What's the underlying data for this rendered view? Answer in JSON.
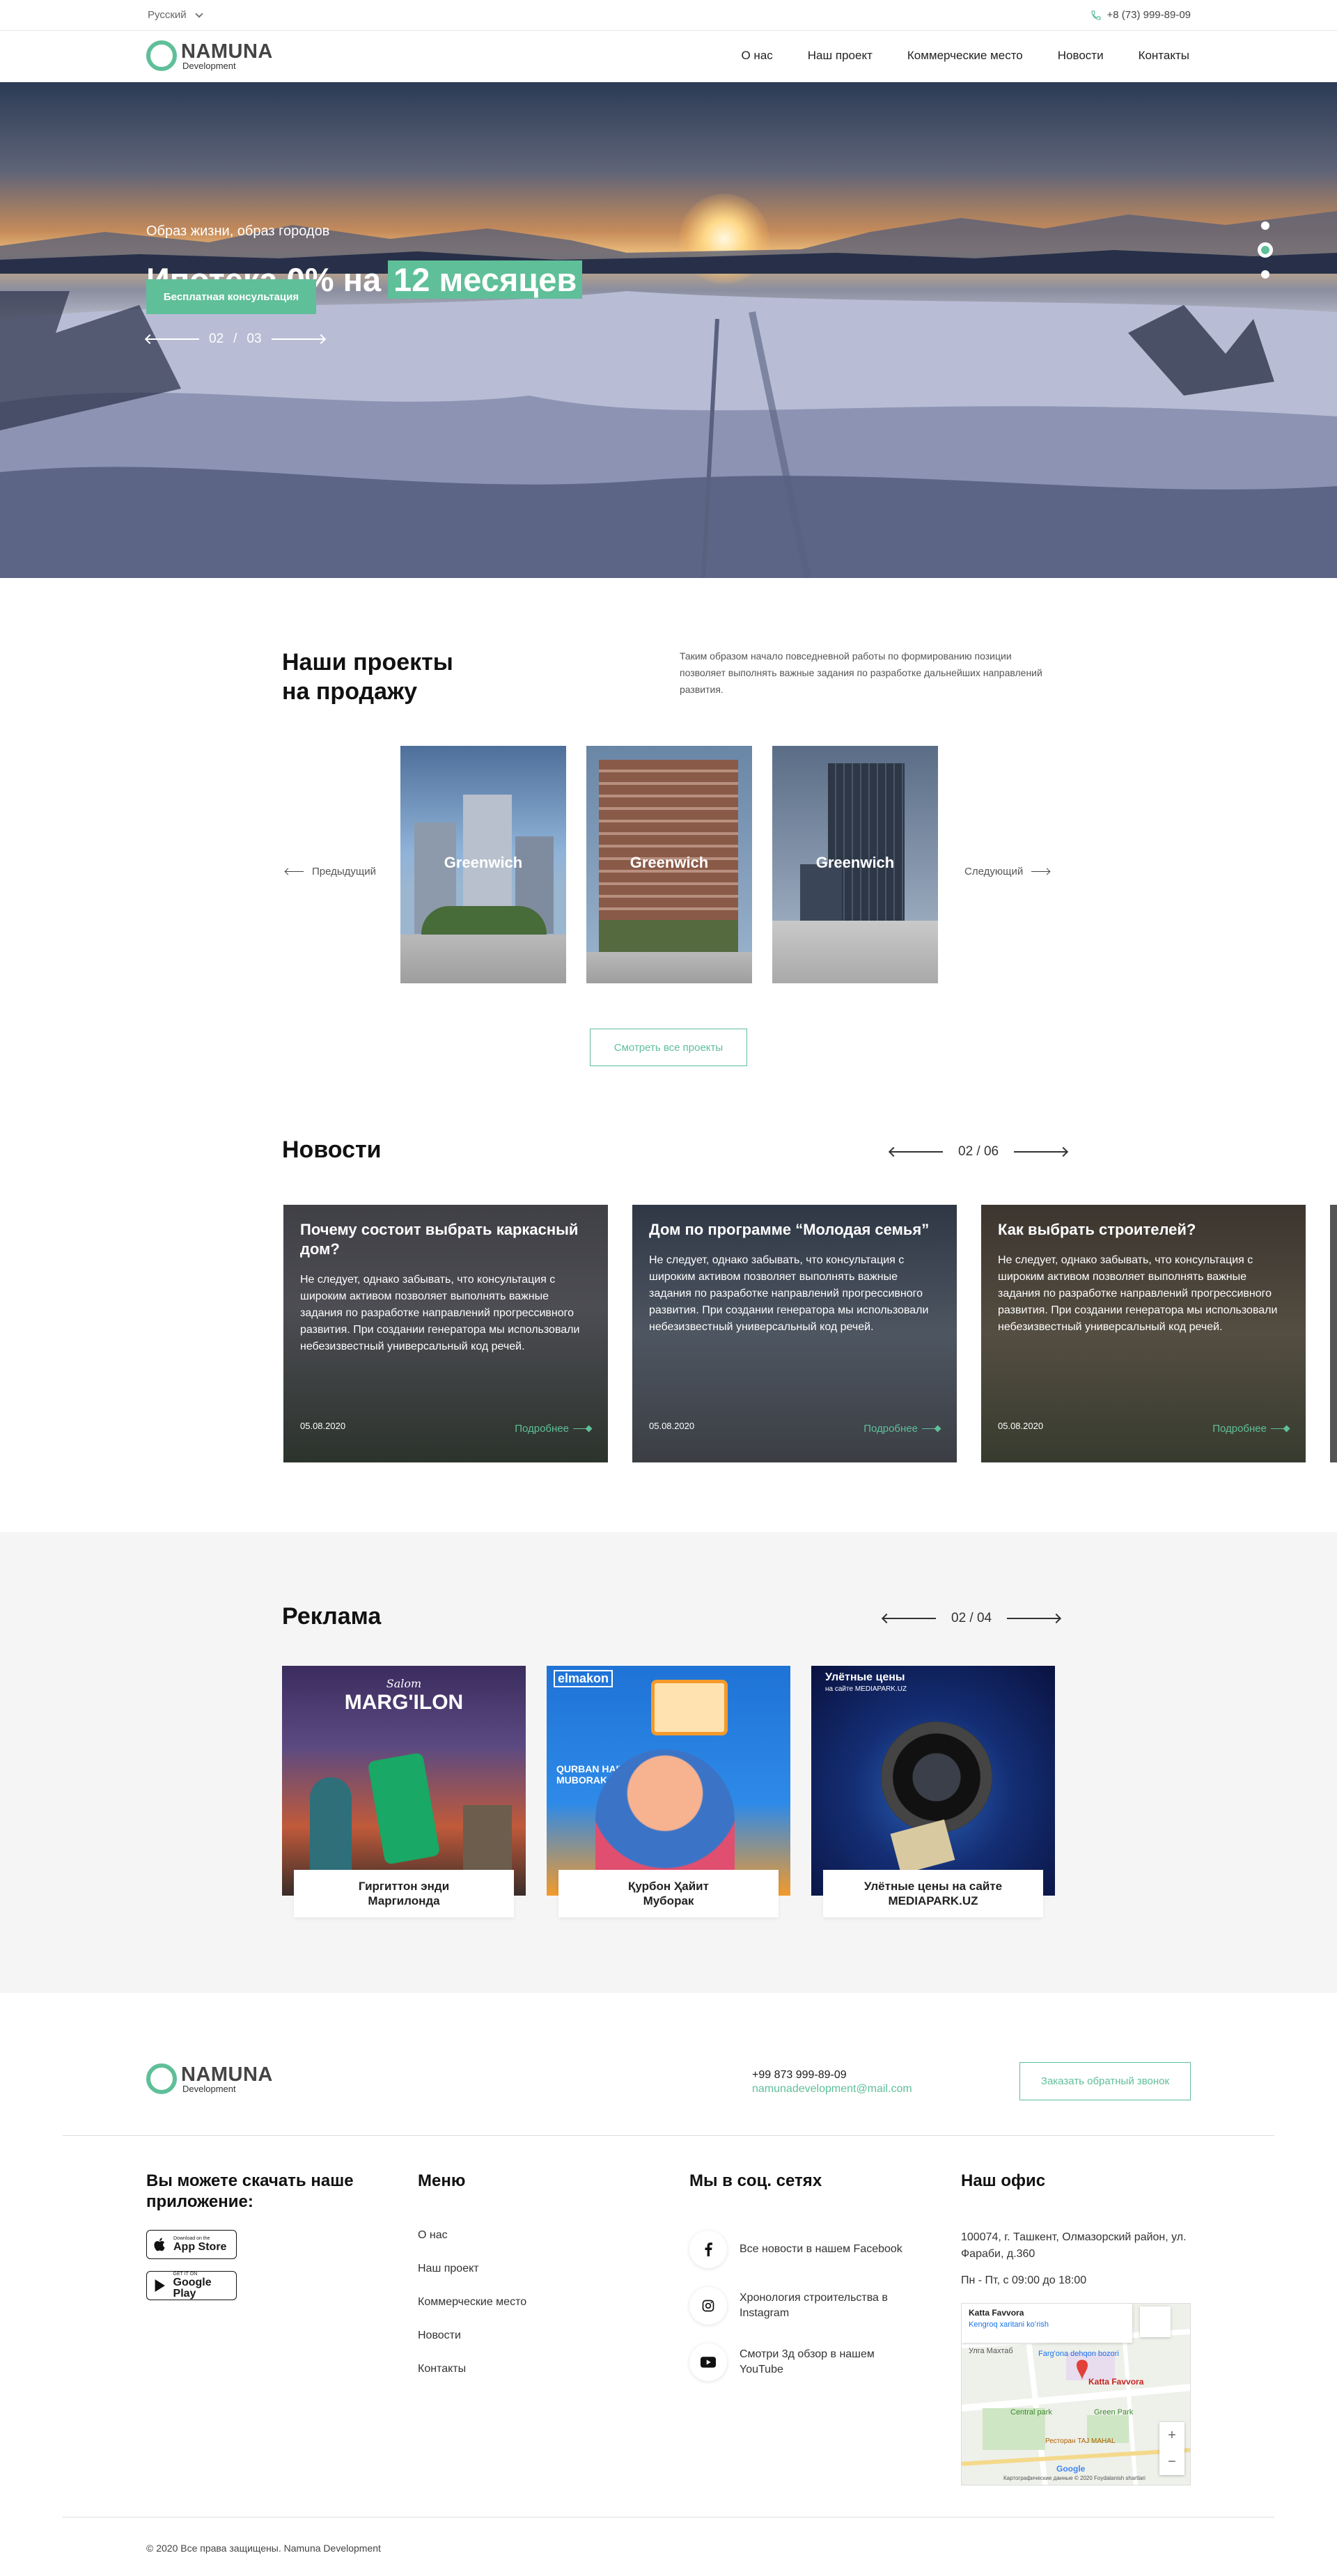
{
  "topbar": {
    "language": "Русский",
    "phone": "+8 (73) 999-89-09"
  },
  "logo": {
    "brand": "NAMUNA",
    "sub": "Development"
  },
  "nav": [
    "О нас",
    "Наш проект",
    "Коммерческие место",
    "Новости",
    "Контакты"
  ],
  "hero": {
    "title_part1": "Ипотека 0% на",
    "title_highlight": "12 месяцев",
    "subtitle": "Образ жизни, образ городов",
    "cta": "Бесплатная консультация",
    "pager_current": "02",
    "pager_sep": "/",
    "pager_total": "03"
  },
  "projects": {
    "title_line1": "Наши проекты",
    "title_line2": "на продажу",
    "description": "Таким образом начало повседневной работы по формированию позиции позволяет выполнять важные задания по разработке дальнейших направлений развития.",
    "prev": "Предыдущий",
    "next": "Следующий",
    "cards": [
      "Greenwich",
      "Greenwich",
      "Greenwich"
    ],
    "view_all": "Смотреть все проекты"
  },
  "news": {
    "title": "Новости",
    "pager_current": "02",
    "pager_sep": "/",
    "pager_total": "06",
    "items": [
      {
        "title": "Почему состоит выбрать каркасный дом?",
        "text": "Не следует, однако забывать, что консультация с широким активом позволяет выполнять важные задания по разработке направлений прогрессивного развития. При создании генератора мы использовали небезизвестный универсальный код речей.",
        "date": "05.08.2020",
        "more": "Подробнее"
      },
      {
        "title": "Дом по программе “Молодая семья”",
        "text": "Не следует, однако забывать, что консультация с широким активом позволяет выполнять важные задания по разработке направлений прогрессивного развития. При создании генератора мы использовали небезизвестный универсальный код речей.",
        "date": "05.08.2020",
        "more": "Подробнее"
      },
      {
        "title": "Как выбрать строителей?",
        "text": "Не следует, однако забывать, что консультация с широким активом позволяет выполнять важные задания по разработке направлений прогрессивного развития. При создании генератора мы использовали небезизвестный универсальный код речей.",
        "date": "05.08.2020",
        "more": "Подробнее"
      }
    ]
  },
  "ads": {
    "title": "Реклама",
    "pager_current": "02",
    "pager_sep": "/",
    "pager_total": "04",
    "items": [
      {
        "caption_line1": "Гиргиттон энди",
        "caption_line2": "Маргилонда",
        "banner_top": "Salom",
        "banner_main": "MARG'ILON"
      },
      {
        "caption_line1": "Қурбон Ҳайит",
        "caption_line2": "Муборак",
        "banner_top": "elmakon",
        "banner_main": "QURBAN HAIT MUBORAK"
      },
      {
        "caption_line1": "Улётные цены на сайте",
        "caption_line2": "MEDIAPARK.UZ",
        "banner_top": "Улётные цены",
        "banner_main": "на сайте MEDIAPARK.UZ"
      }
    ]
  },
  "footer": {
    "phone": "+99 873 999-89-09",
    "email": "namunadevelopment@mail.com",
    "callback": "Заказать обратный звонок",
    "app_title": "Вы можете скачать наше приложение:",
    "appstore_small": "Download on the",
    "appstore_big": "App Store",
    "googleplay_small": "GET IT ON",
    "googleplay_big": "Google Play",
    "menu_title": "Меню",
    "menu": [
      "О нас",
      "Наш проект",
      "Коммерческие место",
      "Новости",
      "Контакты"
    ],
    "social_title": "Мы в соц. сетях",
    "social": [
      {
        "icon": "facebook-icon",
        "text": "Все новости в нашем Facebook"
      },
      {
        "icon": "instagram-icon",
        "text": "Хронология строительства в Instagram"
      },
      {
        "icon": "youtube-icon",
        "text": "Смотри 3д обзор в нашем YouTube"
      }
    ],
    "office_title": "Наш офис",
    "office_address": "100074, г. Ташкент, Олмазорский район, ул. Фараби, д.360",
    "office_hours": "Пн - Пт, с 09:00 до 18:00",
    "map": {
      "place": "Katta Favvora",
      "place_link": "Kengroq xaritani koʻrish",
      "poi1": "Farg'ona dehqon bozori",
      "poi2": "Katta Favvora",
      "poi3": "Central park",
      "poi4": "Green Park",
      "poi5": "Ресторан TAJ MAHAL",
      "street": "Улга Махтаб",
      "brand": "Google",
      "attribution": "Картографические данные © 2020   Foydalanish shartlari"
    },
    "copyright": "© 2020 Все права защищены. Namuna Development"
  },
  "colors": {
    "accent": "#5fbf99",
    "ads_band": "#f5f5f5"
  }
}
